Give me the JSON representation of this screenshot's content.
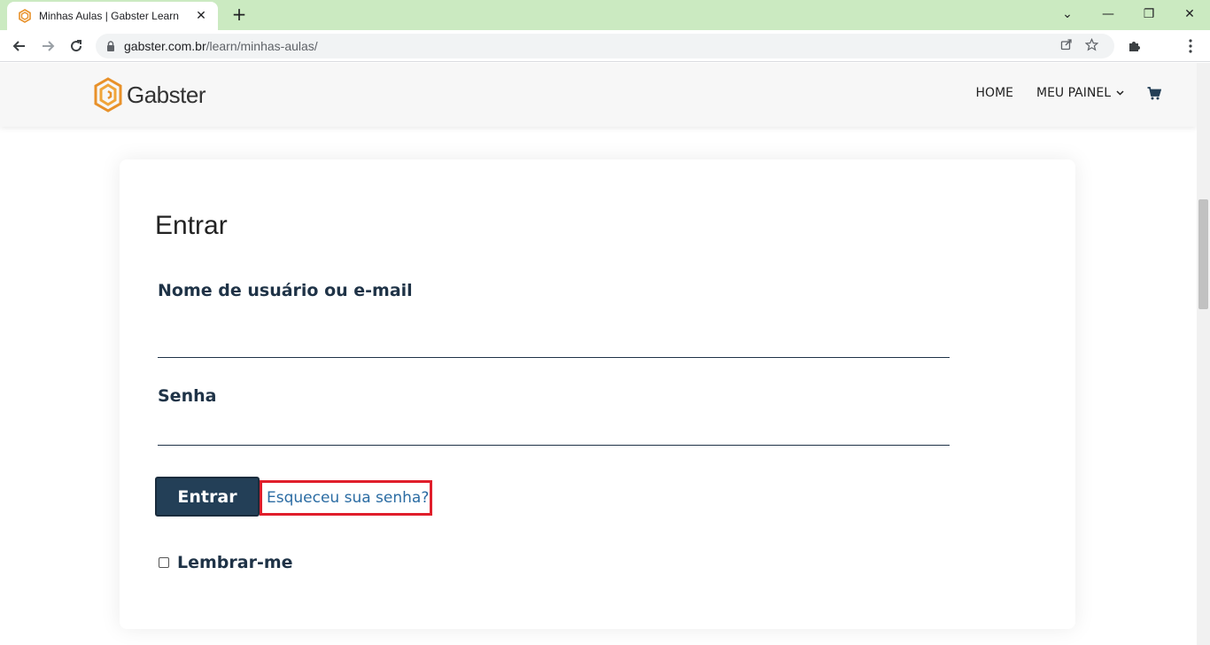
{
  "browser": {
    "tab_title": "Minhas Aulas | Gabster Learn",
    "tab_close": "✕",
    "new_tab": "+",
    "url_host": "gabster.com.br",
    "url_path": "/learn/minhas-aulas/",
    "win_minimize": "—",
    "win_restore": "❐",
    "win_close": "✕",
    "dropdown": "⌄"
  },
  "header": {
    "logo_text": "Gabster",
    "menu": [
      {
        "label": "HOME"
      },
      {
        "label": "MEU PAINEL"
      }
    ],
    "accent_color": "#e8912a"
  },
  "login": {
    "title": "Entrar",
    "username_label": "Nome de usuário ou e-mail",
    "password_label": "Senha",
    "submit_label": "Entrar",
    "forgot_label": "Esqueceu sua senha?",
    "remember_label": "Lembrar-me",
    "highlight_color": "#e01e2b"
  }
}
